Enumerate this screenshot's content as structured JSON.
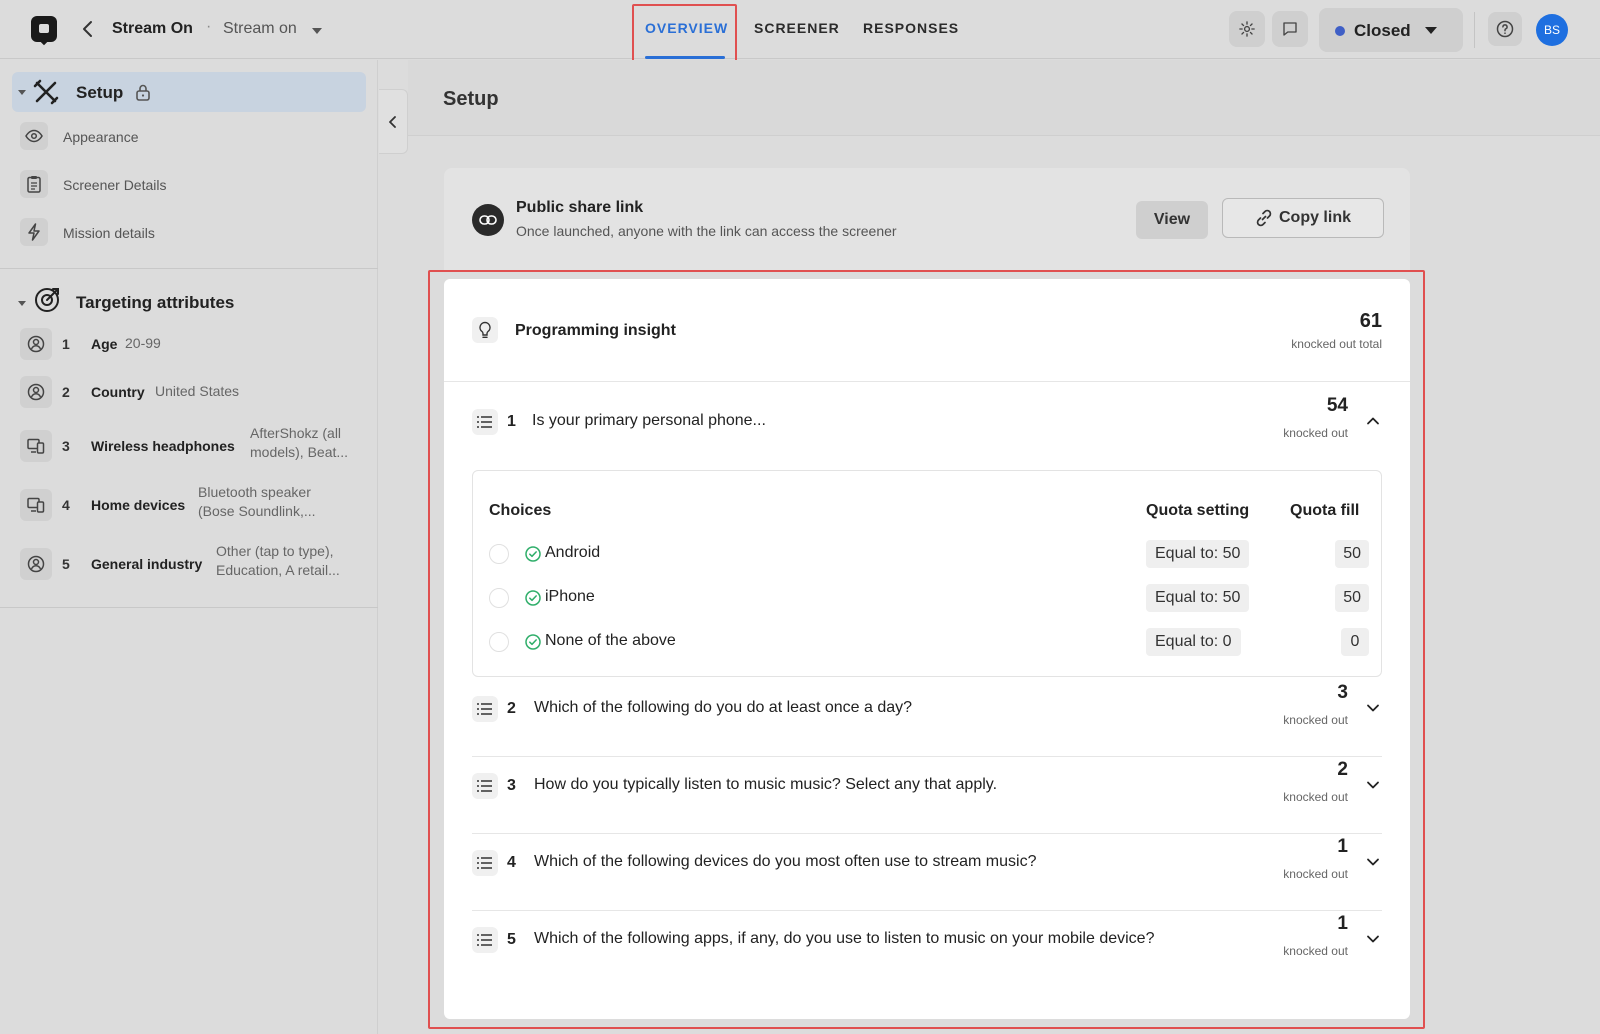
{
  "header": {
    "project_name": "Stream On",
    "separator": "·",
    "project_sub": "Stream on",
    "tabs": [
      {
        "label": "OVERVIEW",
        "active": true
      },
      {
        "label": "SCREENER",
        "active": false
      },
      {
        "label": "RESPONSES",
        "active": false
      }
    ],
    "status_label": "Closed",
    "status_color": "#3f5fc6",
    "avatar_initials": "BS",
    "accent_color": "#2a6fd6"
  },
  "sidebar": {
    "setup_title": "Setup",
    "setup_items": [
      {
        "label": "Appearance",
        "icon": "eye-icon"
      },
      {
        "label": "Screener Details",
        "icon": "clipboard-icon"
      },
      {
        "label": "Mission details",
        "icon": "lightning-icon"
      }
    ],
    "targeting_title": "Targeting attributes",
    "attributes": [
      {
        "num": "1",
        "name": "Age",
        "value": "20-99"
      },
      {
        "num": "2",
        "name": "Country",
        "value": "United States"
      },
      {
        "num": "3",
        "name": "Wireless headphones",
        "value": "AfterShokz (all models), Beat..."
      },
      {
        "num": "4",
        "name": "Home devices",
        "value": "Bluetooth speaker (Bose Soundlink,..."
      },
      {
        "num": "5",
        "name": "General industry",
        "value": "Other (tap to type), Education, A retail..."
      }
    ]
  },
  "main": {
    "title": "Setup",
    "share": {
      "title": "Public share link",
      "description": "Once launched, anyone with the link can access the screener",
      "view_label": "View",
      "copy_label": "Copy link"
    },
    "insight": {
      "title": "Programming insight",
      "total": "61",
      "total_label": "knocked out total",
      "choices_header": "Choices",
      "quota_setting_header": "Quota setting",
      "quota_fill_header": "Quota fill",
      "questions": [
        {
          "num": "1",
          "text": "Is your primary personal phone...",
          "count": "54",
          "count_label": "knocked out",
          "expanded": true
        },
        {
          "num": "2",
          "text": "Which of the following do you do at least once a day?",
          "count": "3",
          "count_label": "knocked out"
        },
        {
          "num": "3",
          "text": "How do you typically listen to music music? Select any that apply.",
          "count": "2",
          "count_label": "knocked out"
        },
        {
          "num": "4",
          "text": "Which of the following devices do you most often use to stream music?",
          "count": "1",
          "count_label": "knocked out"
        },
        {
          "num": "5",
          "text": "Which of the following apps, if any, do you use to listen to music on your mobile device?",
          "count": "1",
          "count_label": "knocked out"
        }
      ],
      "choices": [
        {
          "label": "Android",
          "quota": "Equal to: 50",
          "fill": "50"
        },
        {
          "label": "iPhone",
          "quota": "Equal to: 50",
          "fill": "50"
        },
        {
          "label": "None of the above",
          "quota": "Equal to: 0",
          "fill": "0"
        }
      ]
    }
  }
}
